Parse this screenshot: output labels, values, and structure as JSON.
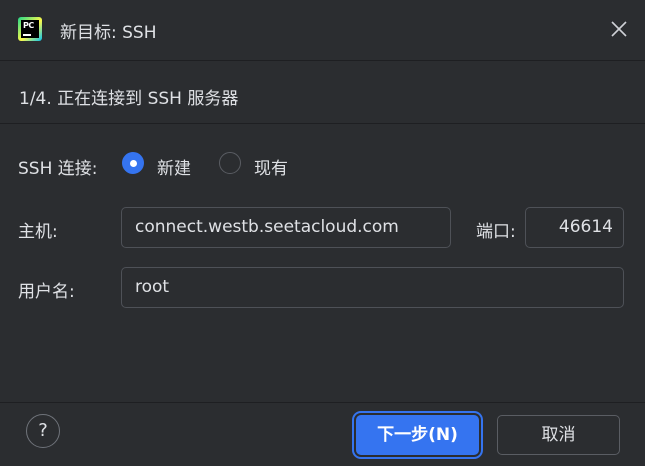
{
  "window": {
    "title": "新目标: SSH",
    "app_icon": "pycharm-logo",
    "app_icon_text": "PC"
  },
  "step": {
    "text": "1/4. 正在连接到 SSH 服务器"
  },
  "form": {
    "ssh_connection_label": "SSH 连接:",
    "options": [
      {
        "label": "新建",
        "selected": true
      },
      {
        "label": "现有",
        "selected": false
      }
    ],
    "host_label": "主机:",
    "host_value": "connect.westb.seetacloud.com",
    "port_label": "端口:",
    "port_value": "46614",
    "username_label": "用户名:",
    "username_value": "root"
  },
  "footer": {
    "help_label": "?",
    "next_label": "下一步(N)",
    "cancel_label": "取消"
  },
  "colors": {
    "background": "#2b2d30",
    "accent": "#3574f0",
    "text": "#dfe1e5",
    "border": "#4e5157"
  }
}
